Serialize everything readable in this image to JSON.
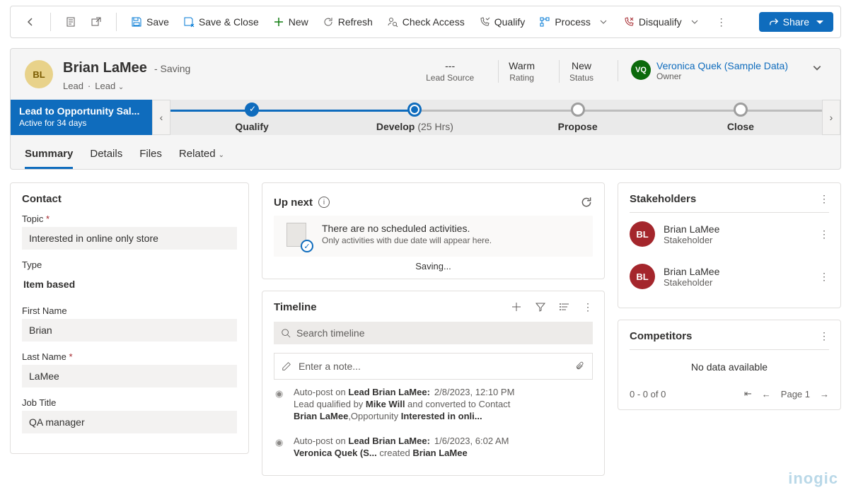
{
  "commands": {
    "save": "Save",
    "save_close": "Save & Close",
    "new": "New",
    "refresh": "Refresh",
    "check_access": "Check Access",
    "qualify": "Qualify",
    "process": "Process",
    "disqualify": "Disqualify",
    "share": "Share"
  },
  "header": {
    "initials": "BL",
    "title": "Brian LaMee",
    "status": "- Saving",
    "entity": "Lead",
    "form": "Lead",
    "fields": {
      "lead_source": {
        "value": "---",
        "label": "Lead Source"
      },
      "rating": {
        "value": "Warm",
        "label": "Rating"
      },
      "status": {
        "value": "New",
        "label": "Status"
      }
    },
    "owner": {
      "initials": "VQ",
      "name": "Veronica Quek (Sample Data)",
      "role": "Owner"
    }
  },
  "bpf": {
    "name": "Lead to Opportunity Sal...",
    "duration": "Active for 34 days",
    "stages": {
      "qualify": "Qualify",
      "develop": "Develop",
      "develop_d": "(25 Hrs)",
      "propose": "Propose",
      "close": "Close"
    }
  },
  "tabs": {
    "summary": "Summary",
    "details": "Details",
    "files": "Files",
    "related": "Related"
  },
  "contact": {
    "section": "Contact",
    "topic_label": "Topic",
    "topic": "Interested in online only store",
    "type_label": "Type",
    "type": "Item based",
    "first_label": "First Name",
    "first": "Brian",
    "last_label": "Last Name",
    "last": "LaMee",
    "job_label": "Job Title",
    "job": "QA manager"
  },
  "upnext": {
    "title": "Up next",
    "msg1": "There are no scheduled activities.",
    "msg2": "Only activities with due date will appear here.",
    "saving": "Saving..."
  },
  "timeline": {
    "title": "Timeline",
    "search_ph": "Search timeline",
    "note_ph": "Enter a note...",
    "items": [
      {
        "prefix": "Auto-post on ",
        "subject": "Lead Brian LaMee:",
        "date": "2/8/2023, 12:10 PM",
        "body_pre": "Lead qualified by ",
        "body_b1": "Mike Will",
        "body_mid": " and converted to Contact ",
        "body_b2": "Brian LaMee",
        "body_mid2": ",Opportunity ",
        "body_b3": "Interested in onli..."
      },
      {
        "prefix": "Auto-post on ",
        "subject": "Lead Brian LaMee:",
        "date": "1/6/2023, 6:02 AM",
        "body_b1": "Veronica Quek (S...",
        "body_mid": "  created ",
        "body_b2": "Brian LaMee"
      }
    ]
  },
  "stakeholders": {
    "title": "Stakeholders",
    "rows": [
      {
        "initials": "BL",
        "name": "Brian LaMee",
        "role": "Stakeholder"
      },
      {
        "initials": "BL",
        "name": "Brian LaMee",
        "role": "Stakeholder"
      }
    ]
  },
  "competitors": {
    "title": "Competitors",
    "nodata": "No data available",
    "range": "0 - 0 of 0",
    "page": "Page 1"
  },
  "watermark": "inogic"
}
